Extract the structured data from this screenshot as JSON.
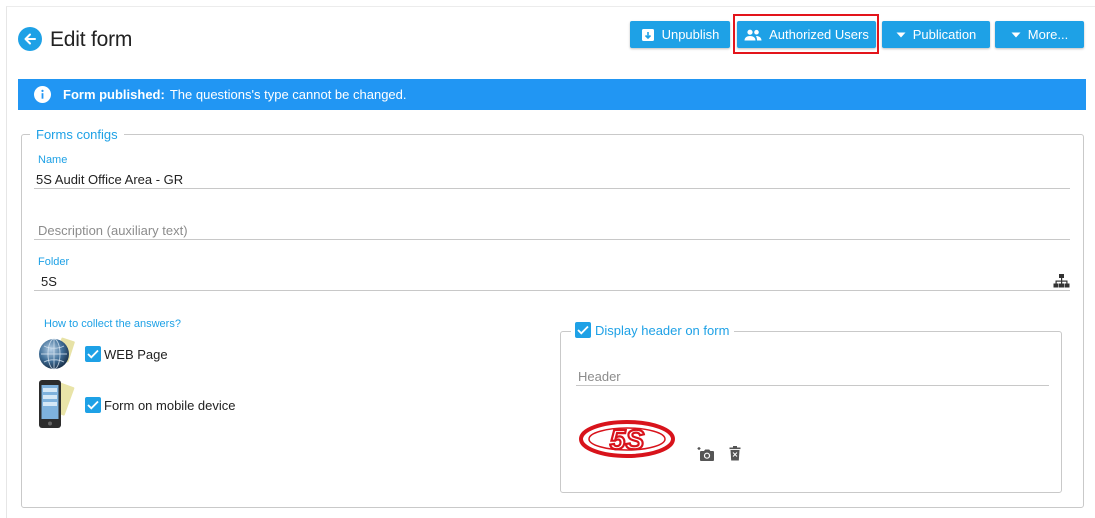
{
  "header": {
    "title": "Edit form",
    "back_icon": "arrow-left-icon"
  },
  "toolbar": {
    "unpublish_label": "Unpublish",
    "authorized_users_label": "Authorized Users",
    "publication_label": "Publication",
    "more_label": "More..."
  },
  "banner": {
    "bold": "Form published:",
    "message": "The questions's type cannot be changed."
  },
  "form": {
    "legend": "Forms configs",
    "name_label": "Name",
    "name_value": "5S Audit Office Area - GR",
    "description_placeholder": "Description (auxiliary text)",
    "folder_label": "Folder",
    "folder_value": "5S"
  },
  "collect": {
    "label": "How to collect the answers?",
    "web_label": "WEB Page",
    "web_checked": true,
    "mobile_label": "Form on mobile device",
    "mobile_checked": true
  },
  "header_box": {
    "legend": "Display header on form",
    "checked": true,
    "header_placeholder": "Header",
    "logo_text": "5S"
  },
  "colors": {
    "accent": "#1ea1e6",
    "banner": "#2196f3",
    "highlight": "#e3141b",
    "logo": "#d8131b"
  }
}
